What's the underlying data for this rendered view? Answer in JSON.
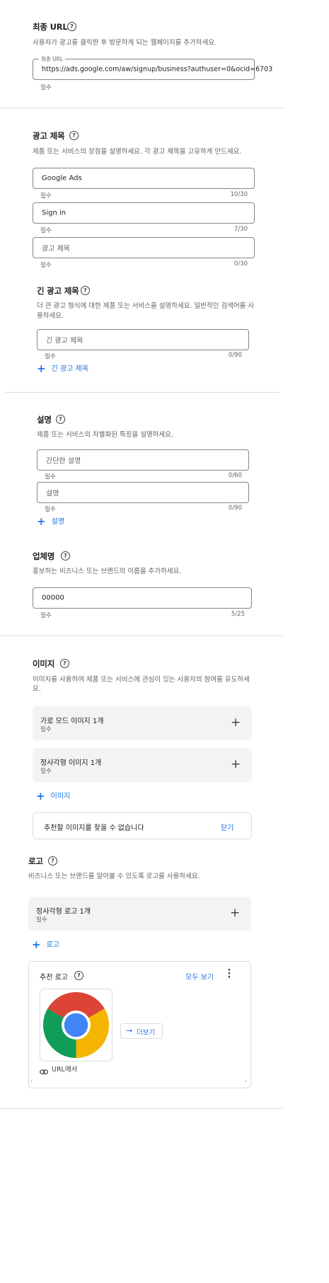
{
  "final_url": {
    "title": "최종 URL",
    "description": "사용자가 광고를 클릭한 후 방문하게 되는 웹페이지를 추가하세요.",
    "field_label": "최종 URL",
    "value": "https://ads.google.com/aw/signup/business?authuser=0&ocid=6703",
    "hint": "필수"
  },
  "headlines": {
    "title": "광고 제목",
    "description": "제품 또는 서비스의 장점을 설명하세요. 각 광고 제목을 고유하게 만드세요.",
    "items": [
      {
        "value": "Google Ads",
        "hint": "필수",
        "count": "10/30"
      },
      {
        "value": "Sign in",
        "hint": "필수",
        "count": "7/30"
      },
      {
        "placeholder": "광고 제목",
        "hint": "필수",
        "count": "0/30"
      }
    ]
  },
  "long_headline": {
    "title": "긴 광고 제목",
    "description_line1": "더 큰 광고 형식에 대한 제품 또는 서비스를 설명하세요. 일반적인 검색어를 사",
    "description_line2": "용하세요.",
    "placeholder": "긴 광고 제목",
    "hint": "필수",
    "count": "0/90",
    "add_label": "긴 광고 제목"
  },
  "descriptions": {
    "title": "설명",
    "description": "제품 또는 서비스의 차별화된 특징을 설명하세요.",
    "items": [
      {
        "placeholder": "간단한 설명",
        "hint": "필수",
        "count": "0/60"
      },
      {
        "placeholder": "설명",
        "hint": "필수",
        "count": "0/90"
      }
    ],
    "add_label": "설명"
  },
  "business_name": {
    "title": "업체명",
    "description": "홍보하는 비즈니스 또는 브랜드의 이름을 추가하세요.",
    "value": "00000",
    "hint": "필수",
    "count": "5/25"
  },
  "images": {
    "title": "이미지",
    "description_line1": "이미지를 사용하여 제품 또는 서비스에 관심이 있는 사용자의 참여를 유도하세",
    "description_line2": "요.",
    "slots": [
      {
        "label": "가로 모드 이미지 1개",
        "sub": "필수"
      },
      {
        "label": "정사각형 이미지 1개",
        "sub": "필수"
      }
    ],
    "add_label": "이미지",
    "notice": "추천할 이미지를 찾을 수 없습니다",
    "close_label": "닫기"
  },
  "logos": {
    "title": "로고",
    "description": "비즈니스 또는 브랜드를 알아볼 수 있도록 로고를 사용하세요.",
    "slot": {
      "label": "정사각형 로고 1개",
      "sub": "필수"
    },
    "add_label": "로고",
    "recommended": {
      "title": "추천 로고",
      "view_all": "모두 보기",
      "more_label": "더보기",
      "source": "URL에서"
    }
  },
  "colors": {
    "accent": "#1a73e8",
    "panel_bg": "#f1f3f4",
    "divider": "#dadce0"
  },
  "icons": [
    "help-circle-icon",
    "plus-icon",
    "arrow-right-icon",
    "link-icon",
    "more-vert-icon",
    "chevron-left-icon",
    "chevron-right-icon"
  ]
}
